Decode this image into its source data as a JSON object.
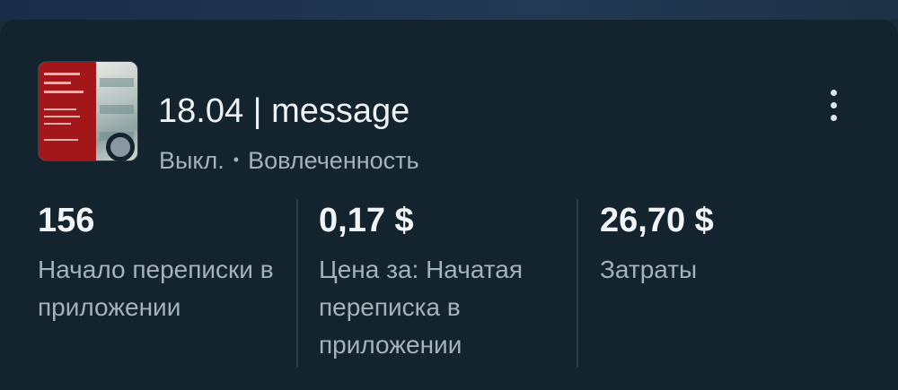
{
  "card": {
    "title": "18.04 | message",
    "status": "Выкл.",
    "separator": "•",
    "objective": "Вовлеченность",
    "thumbnail_icon": "ad-thumbnail-image",
    "status_dot_color": "#8a97a1",
    "more_icon": "more-vertical-icon"
  },
  "metrics": [
    {
      "value": "156",
      "label": "Начало переписки в приложении"
    },
    {
      "value": "0,17 $",
      "label": "Цена за: Начатая переписка в приложении"
    },
    {
      "value": "26,70 $",
      "label": "Затраты"
    }
  ],
  "colors": {
    "background": "#13242f",
    "text_primary": "#eef2f5",
    "text_secondary": "#a6b1b9"
  }
}
